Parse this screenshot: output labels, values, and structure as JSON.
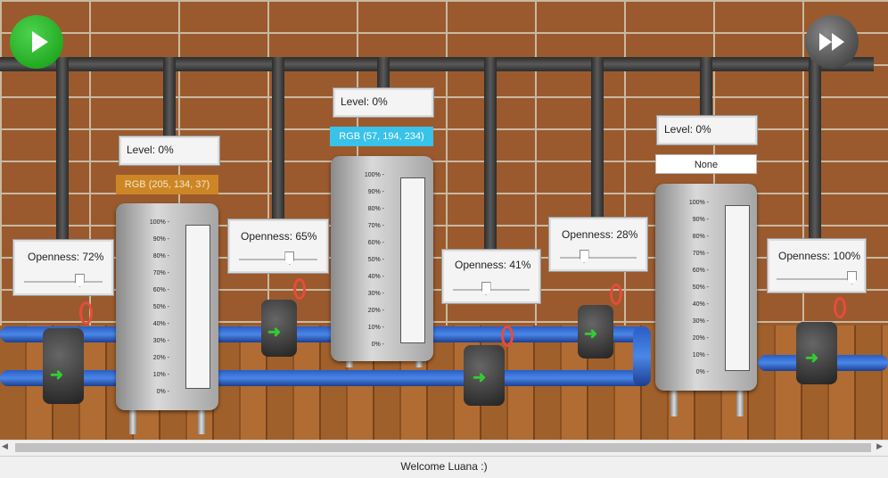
{
  "controls": {
    "play": "play-icon",
    "fast_forward": "fast-forward-icon"
  },
  "tanks": [
    {
      "level_label": "Level: 0%",
      "color_label": "RGB (205, 134, 37)",
      "color": "#cd8625",
      "text_color": "#f5e6c8",
      "level": 0
    },
    {
      "level_label": "Level: 0%",
      "color_label": "RGB (57, 194, 234)",
      "color": "#39c2ea",
      "text_color": "#ffffff",
      "level": 0
    },
    {
      "level_label": "Level: 0%",
      "color_label": "None",
      "color": "#ffffff",
      "text_color": "#222222",
      "level": 0
    }
  ],
  "gauge_ticks": [
    "100%",
    "90%",
    "80%",
    "70%",
    "60%",
    "50%",
    "40%",
    "30%",
    "20%",
    "10%",
    "0%"
  ],
  "valves": [
    {
      "label": "Openness: 72%",
      "openness": 0.72
    },
    {
      "label": "Openness: 65%",
      "openness": 0.65
    },
    {
      "label": "Openness: 41%",
      "openness": 0.41
    },
    {
      "label": "Openness: 28%",
      "openness": 0.28
    },
    {
      "label": "Openness: 100%",
      "openness": 1.0
    }
  ],
  "status": {
    "text": "Welcome Luana :)"
  },
  "scrollbar": {
    "left": "◀",
    "right": "▶"
  }
}
